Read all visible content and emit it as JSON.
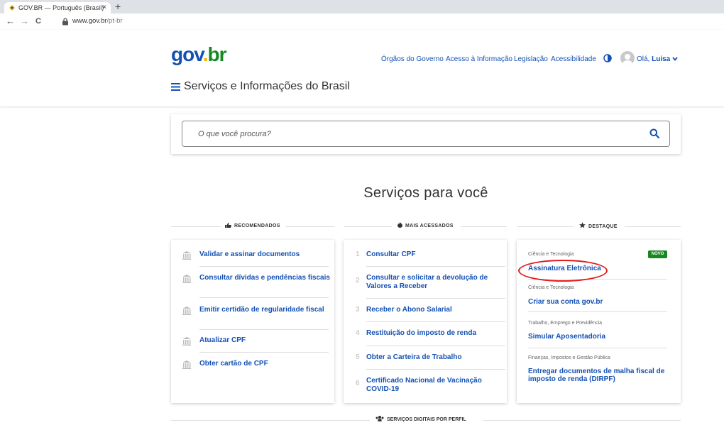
{
  "browser": {
    "tab_title": "GOV.BR — Português (Brasil)",
    "tab_close": "×",
    "new_tab": "+",
    "back": "←",
    "forward": "→",
    "reload": "C",
    "url_host": "www.gov.br",
    "url_path": "/pt-br"
  },
  "header": {
    "logo": {
      "g": "g",
      "o": "o",
      "v": "v",
      "dot": ".",
      "br": "br"
    },
    "links": [
      "Órgãos do Governo",
      "Acesso à Informação",
      "Legislação",
      "Acessibilidade"
    ],
    "greeting": "Olá,",
    "user": "Luisa",
    "site_title": "Serviços e Informações do Brasil"
  },
  "search": {
    "placeholder": "O que você procura?"
  },
  "services": {
    "title": "Serviços para você",
    "recomendados": {
      "label": "RECOMENDADOS",
      "items": [
        "Validar e assinar documentos",
        "Consultar dívidas e pendências fiscais",
        "Emitir certidão de regularidade fiscal",
        "Atualizar CPF",
        "Obter cartão de CPF"
      ]
    },
    "mais_acessados": {
      "label": "MAIS ACESSADOS",
      "items": [
        {
          "num": "1",
          "label": "Consultar CPF"
        },
        {
          "num": "2",
          "label": "Consultar e solicitar a devolução de Valores a Receber"
        },
        {
          "num": "3",
          "label": "Receber o Abono Salarial"
        },
        {
          "num": "4",
          "label": "Restituição do imposto de renda"
        },
        {
          "num": "5",
          "label": "Obter a Carteira de Trabalho"
        },
        {
          "num": "6",
          "label": "Certificado Nacional de Vacinação COVID-19"
        }
      ]
    },
    "destaque": {
      "label": "DESTAQUE",
      "badge": "NOVO",
      "items": [
        {
          "category": "Ciência e Tecnologia",
          "label": "Assinatura Eletrônica"
        },
        {
          "category": "Ciência e Tecnologia",
          "label": "Criar sua conta gov.br"
        },
        {
          "category": "Trabalho, Emprego e Previdência",
          "label": "Simular Aposentadoria"
        },
        {
          "category": "Finanças, Impostos e Gestão Pública",
          "label": "Entregar documentos de malha fiscal de imposto de renda (DIRPF)"
        }
      ]
    },
    "perfil_label": "SERVIÇOS DIGITAIS POR PERFIL"
  },
  "colors": {
    "brand_blue": "#1351b4",
    "green": "#168821",
    "yellow": "#f7b500",
    "highlight": "#e21a1a"
  }
}
